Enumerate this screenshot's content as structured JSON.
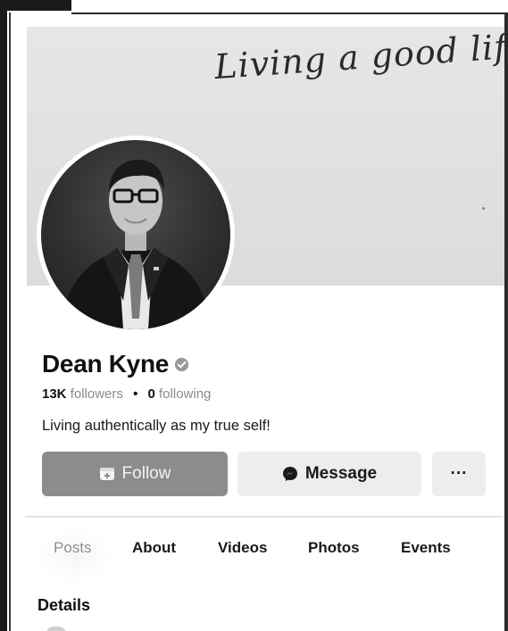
{
  "cover": {
    "script_text": "Living a good life!"
  },
  "profile": {
    "name": "Dean Kyne",
    "followers_count": "13K",
    "followers_label": "followers",
    "separator": "•",
    "following_count": "0",
    "following_label": "following",
    "bio": "Living authentically as my true self!"
  },
  "actions": {
    "follow_label": "Follow",
    "message_label": "Message",
    "more_label": "···"
  },
  "tabs": [
    {
      "label": "Posts",
      "active": true
    },
    {
      "label": "About",
      "active": false
    },
    {
      "label": "Videos",
      "active": false
    },
    {
      "label": "Photos",
      "active": false
    },
    {
      "label": "Events",
      "active": false
    }
  ],
  "section": {
    "details_title": "Details"
  },
  "colors": {
    "follow_bg": "#8c8c8c",
    "secondary_bg": "#ededed",
    "muted_text": "#8a8a8a"
  },
  "icons": {
    "verified": "verified-badge-icon",
    "follow": "follow-user-icon",
    "message": "messenger-icon"
  }
}
